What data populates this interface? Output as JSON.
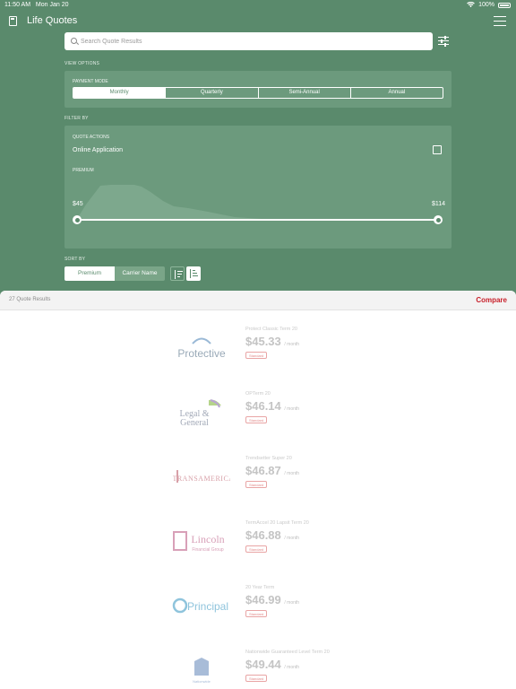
{
  "status_bar": {
    "time": "11:50 AM",
    "date": "Mon Jan 20",
    "battery": "100%"
  },
  "header": {
    "title": "Life Quotes"
  },
  "search": {
    "placeholder": "Search Quote Results"
  },
  "view_options": {
    "section_label": "VIEW OPTIONS",
    "payment_mode_label": "PAYMENT MODE",
    "modes": [
      "Monthly",
      "Quarterly",
      "Semi-Annual",
      "Annual"
    ],
    "selected": "Monthly"
  },
  "filter_by": {
    "section_label": "FILTER BY",
    "quote_actions_label": "QUOTE ACTIONS",
    "online_application_label": "Online Application",
    "online_application_checked": false,
    "premium_label": "PREMIUM",
    "premium_min": "$45",
    "premium_max": "$114"
  },
  "sort_by": {
    "section_label": "SORT BY",
    "options": [
      "Premium",
      "Carrier Name"
    ],
    "selected": "Premium"
  },
  "results": {
    "count_text": "27 Quote Results",
    "compare_label": "Compare",
    "quotes": [
      {
        "carrier": "Protective",
        "product": "Protect Classic Term 20",
        "price": "$45.33",
        "per": "/ month",
        "tag": "Standard"
      },
      {
        "carrier": "Legal & General",
        "product": "OPTerm 20",
        "price": "$46.14",
        "per": "/ month",
        "tag": "Standard"
      },
      {
        "carrier": "Transamerica",
        "product": "Trendsetter Super 20",
        "price": "$46.87",
        "per": "/ month",
        "tag": "Standard"
      },
      {
        "carrier": "Lincoln Financial Group",
        "product": "TermAccel 20 Lapsit Term 20",
        "price": "$46.88",
        "per": "/ month",
        "tag": "Standard"
      },
      {
        "carrier": "Principal",
        "product": "20 Year Term",
        "price": "$46.99",
        "per": "/ month",
        "tag": "Standard"
      },
      {
        "carrier": "Nationwide",
        "product": "Nationwide Guaranteed Level Term 20",
        "price": "$49.44",
        "per": "/ month",
        "tag": "Standard"
      }
    ]
  },
  "colors": {
    "background": "#5a8a6c",
    "panel": "#6c9a7d",
    "accent_red": "#c8202a"
  }
}
